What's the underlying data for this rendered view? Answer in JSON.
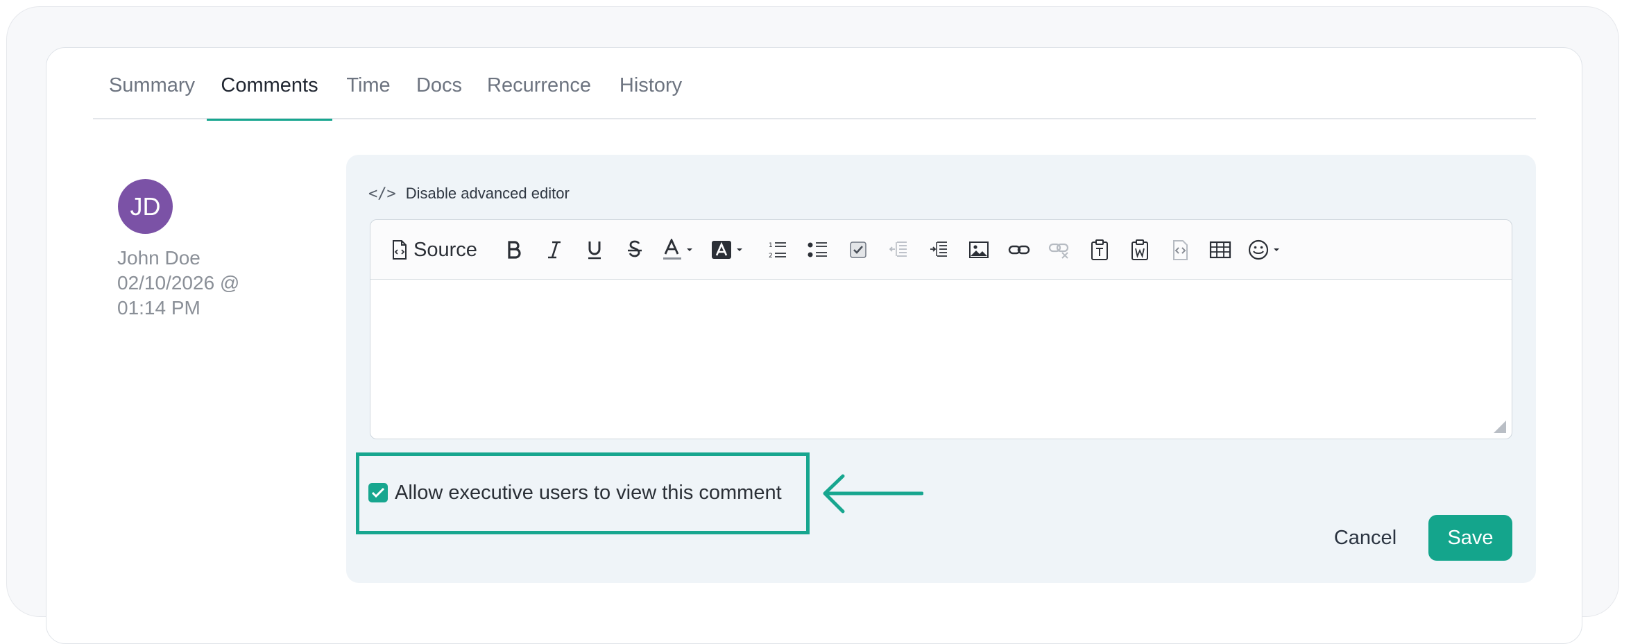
{
  "tabs": [
    {
      "label": "Summary"
    },
    {
      "label": "Comments"
    },
    {
      "label": "Time"
    },
    {
      "label": "Docs"
    },
    {
      "label": "Recurrence"
    },
    {
      "label": "History"
    }
  ],
  "active_tab": "Comments",
  "author": {
    "initials": "JD",
    "name": "John Doe",
    "date_line": "02/10/2026 @",
    "time_line": "01:14 PM"
  },
  "editor": {
    "toggle_label": "Disable advanced editor",
    "source_label": "Source",
    "body": ""
  },
  "comment_visibility": {
    "label": "Allow executive users to view this comment",
    "checked": true
  },
  "actions": {
    "cancel": "Cancel",
    "save": "Save"
  },
  "colors": {
    "accent": "#17a68f",
    "avatar": "#7b52a6",
    "panel": "#eff4f8"
  },
  "icons": [
    "source-icon",
    "bold-icon",
    "italic-icon",
    "underline-icon",
    "strikethrough-icon",
    "text-color-icon",
    "background-color-icon",
    "numbered-list-icon",
    "bulleted-list-icon",
    "checklist-icon",
    "outdent-icon",
    "indent-icon",
    "image-icon",
    "link-icon",
    "unlink-icon",
    "paste-text-icon",
    "paste-word-icon",
    "paste-code-icon",
    "table-icon",
    "emoji-icon",
    "arrow-left-icon"
  ]
}
